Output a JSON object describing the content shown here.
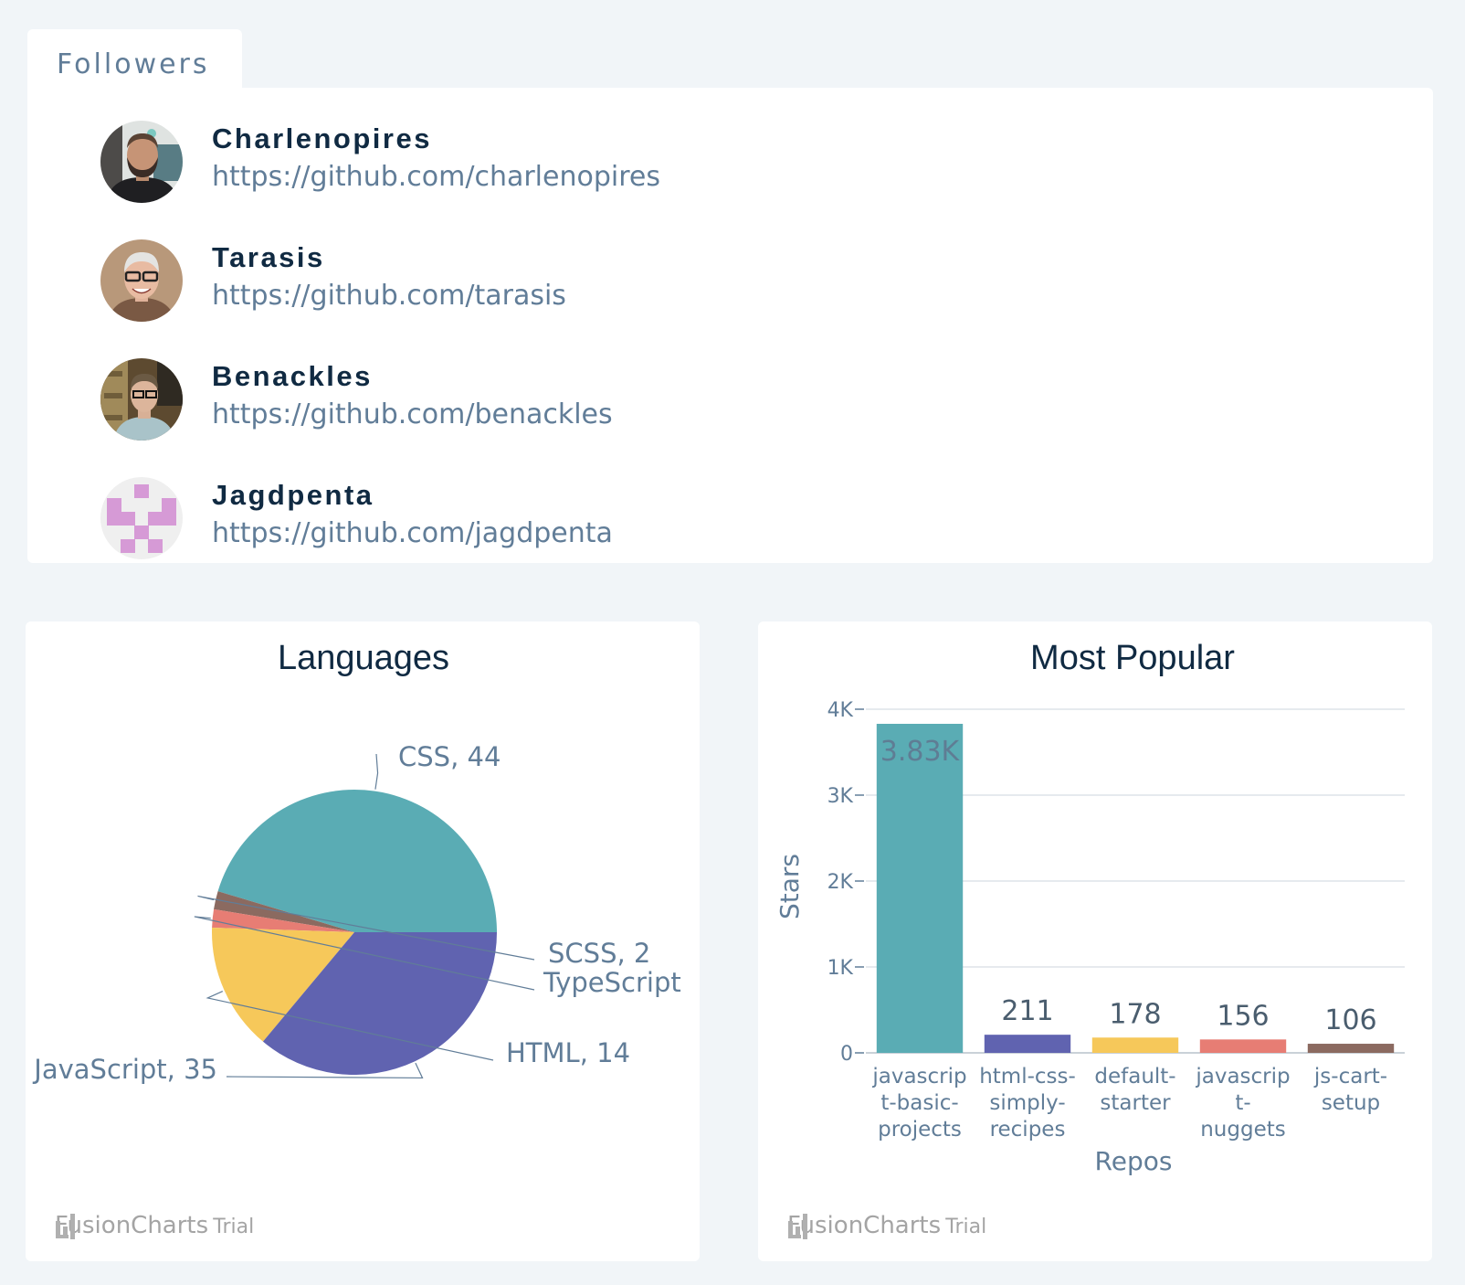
{
  "followers": {
    "tab_label": "Followers",
    "items": [
      {
        "name": "Charlenopires",
        "url": "https://github.com/charlenopires"
      },
      {
        "name": "Tarasis",
        "url": "https://github.com/tarasis"
      },
      {
        "name": "Benackles",
        "url": "https://github.com/benackles"
      },
      {
        "name": "Jagdpenta",
        "url": "https://github.com/jagdpenta"
      }
    ]
  },
  "languages": {
    "watermark_brand": "FusionCharts",
    "watermark_trial": "Trial",
    "chart_data": {
      "type": "pie",
      "title": "Languages",
      "labels": [
        "CSS",
        "SCSS",
        "TypeScript",
        "HTML",
        "JavaScript"
      ],
      "values": [
        44,
        2,
        2,
        14,
        35
      ],
      "data_labels": [
        "CSS, 44",
        "SCSS, 2",
        "TypeScript",
        "HTML, 14",
        "JavaScript, 35"
      ],
      "colors": [
        "#5aacb4",
        "#8b6a60",
        "#e77d74",
        "#f6c85a",
        "#6063b0"
      ]
    }
  },
  "popular": {
    "watermark_brand": "FusionCharts",
    "watermark_trial": "Trial",
    "chart_data": {
      "type": "bar",
      "title": "Most Popular",
      "xlabel": "Repos",
      "ylabel": "Stars",
      "ylim": [
        0,
        4000
      ],
      "yticks": [
        "0",
        "1K",
        "2K",
        "3K",
        "4K"
      ],
      "grid": true,
      "categories": [
        "javascript-basic-projects",
        "html-css-simply-recipes",
        "default-starter",
        "javascript-nuggets",
        "js-cart-setup"
      ],
      "category_lines": [
        [
          "javascrip",
          "t-basic-",
          "projects"
        ],
        [
          "html-css-",
          "simply-",
          "recipes"
        ],
        [
          "default-",
          "starter"
        ],
        [
          "javascrip",
          "t-",
          "nuggets"
        ],
        [
          "js-cart-",
          "setup"
        ]
      ],
      "values": [
        3830,
        211,
        178,
        156,
        106
      ],
      "value_labels": [
        "3.83K",
        "211",
        "178",
        "156",
        "106"
      ],
      "colors": [
        "#5aacb4",
        "#6063b0",
        "#f6c85a",
        "#e77d74",
        "#8b6a60"
      ]
    }
  }
}
